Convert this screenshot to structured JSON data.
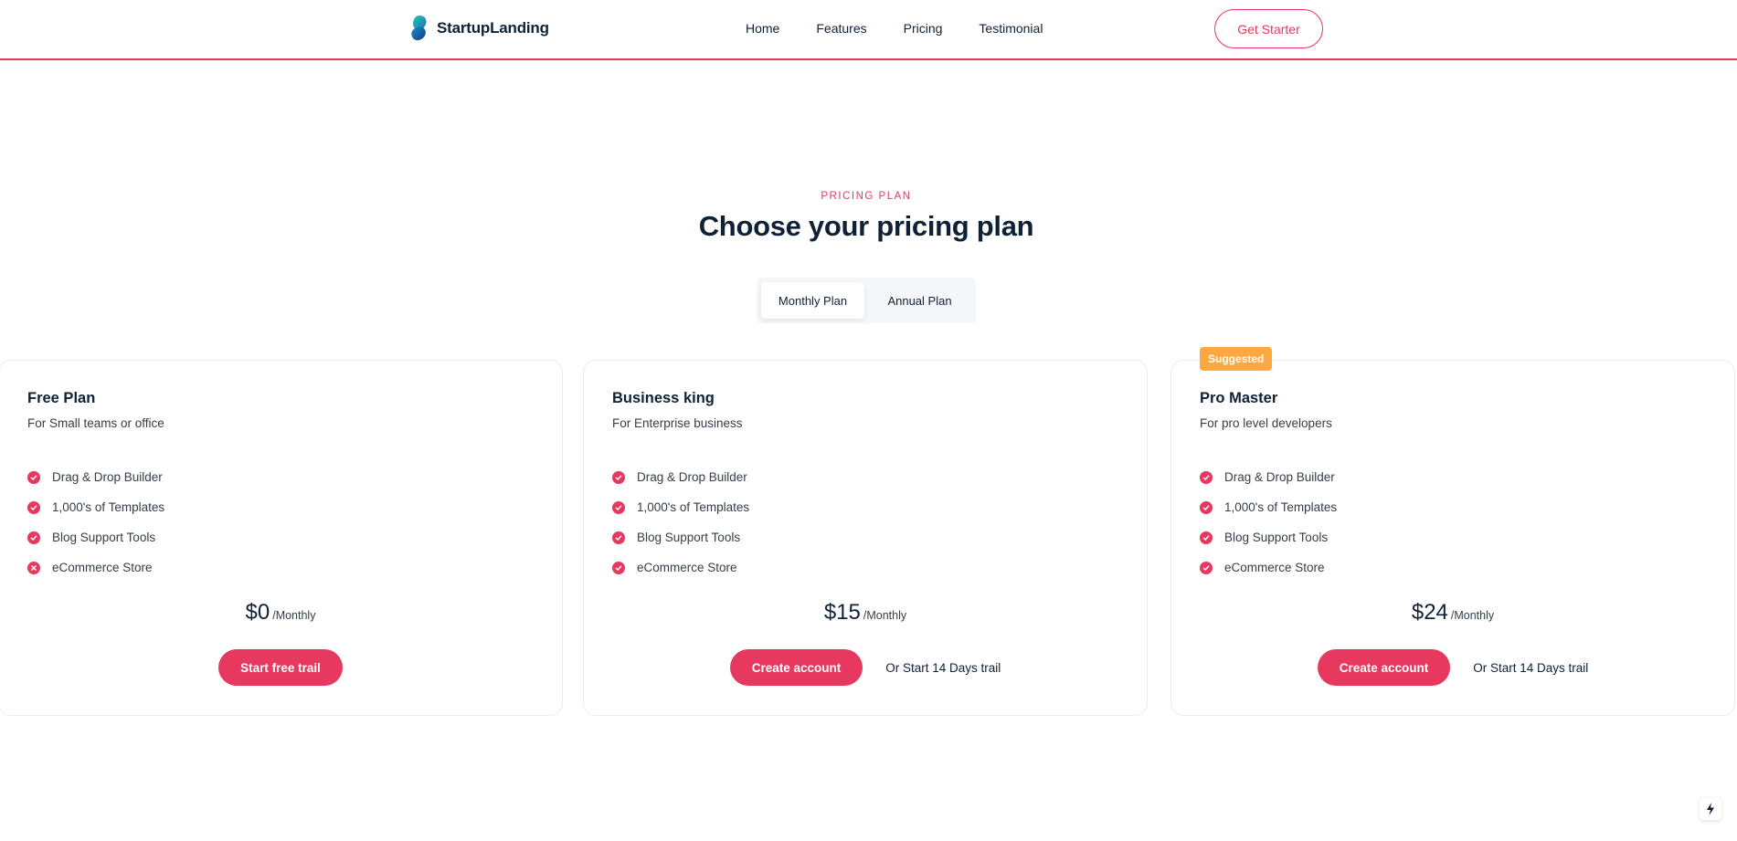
{
  "brand": {
    "name": "StartupLanding",
    "accent_color": "#e7385f",
    "logo_icon": "leaf-logo-icon"
  },
  "nav": {
    "items": [
      "Home",
      "Features",
      "Pricing",
      "Testimonial"
    ],
    "cta_label": "Get Starter"
  },
  "section": {
    "eyebrow": "PRICING PLAN",
    "title": "Choose your pricing plan"
  },
  "toggle": {
    "monthly_label": "Monthly Plan",
    "annual_label": "Annual Plan",
    "selected": "Monthly Plan"
  },
  "plans": [
    {
      "name": "Free Plan",
      "description": "For Small teams or office",
      "features": [
        {
          "label": "Drag & Drop Builder",
          "included": true
        },
        {
          "label": "1,000's of Templates",
          "included": true
        },
        {
          "label": "Blog Support Tools",
          "included": true
        },
        {
          "label": "eCommerce Store",
          "included": false
        }
      ],
      "price": "$0",
      "period": "/Monthly",
      "button_label": "Start free trail",
      "trial_label": ""
    },
    {
      "name": "Business king",
      "description": "For Enterprise business",
      "features": [
        {
          "label": "Drag & Drop Builder",
          "included": true
        },
        {
          "label": "1,000's of Templates",
          "included": true
        },
        {
          "label": "Blog Support Tools",
          "included": true
        },
        {
          "label": "eCommerce Store",
          "included": true
        }
      ],
      "price": "$15",
      "period": "/Monthly",
      "button_label": "Create account",
      "trial_label": "Or Start 14 Days trail"
    },
    {
      "badge": "Suggested",
      "badge_color": "#ffa740",
      "name": "Pro Master",
      "description": "For pro level developers",
      "features": [
        {
          "label": "Drag & Drop Builder",
          "included": true
        },
        {
          "label": "1,000's of Templates",
          "included": true
        },
        {
          "label": "Blog Support Tools",
          "included": true
        },
        {
          "label": "eCommerce Store",
          "included": true
        }
      ],
      "price": "$24",
      "period": "/Monthly",
      "button_label": "Create account",
      "trial_label": "Or Start 14 Days trail"
    }
  ]
}
